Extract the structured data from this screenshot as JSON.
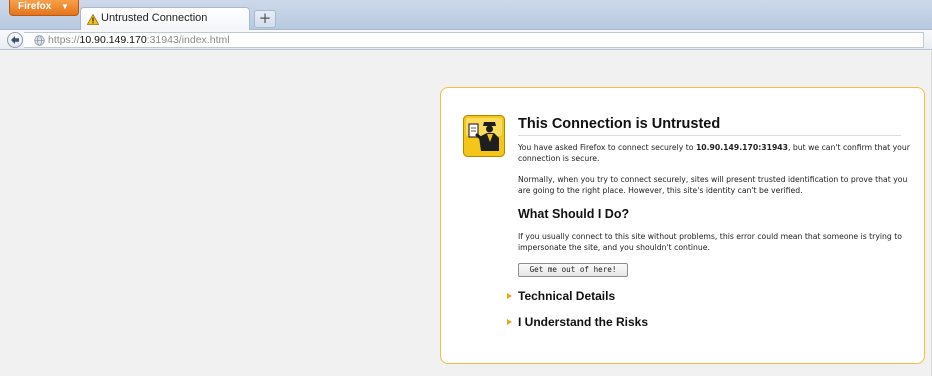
{
  "browser": {
    "menu_button_label": "Firefox",
    "menu_button_caret": "▼",
    "new_tab_label": "+",
    "tab": {
      "title": "Untrusted Connection",
      "icon": "warning-icon"
    }
  },
  "navbar": {
    "back_icon": "back-arrow-icon",
    "site_icon": "globe-icon",
    "url_scheme": "https://",
    "url_host": "10.90.149.170",
    "url_rest": ":31943/index.html"
  },
  "error": {
    "icon": "cert-officer-icon",
    "title": "This Connection is Untrusted",
    "p1_before": "You have asked Firefox to connect securely to ",
    "p1_host": "10.90.149.170:31943",
    "p1_after": ", but we can't confirm that your connection is secure.",
    "p2": "Normally, when you try to connect securely, sites will present trusted identification to prove that you are going to the right place. However, this site's identity can't be verified.",
    "subheading": "What Should I Do?",
    "p3": "If you usually connect to this site without problems, this error could mean that someone is trying to impersonate the site, and you shouldn't continue.",
    "escape_button": "Get me out of here!",
    "expanders": [
      {
        "label": "Technical Details"
      },
      {
        "label": "I Understand the Risks"
      }
    ]
  },
  "colors": {
    "accent": "#e8a317",
    "box_border": "#f2bf3f",
    "firefox_button": "#e3741c"
  }
}
